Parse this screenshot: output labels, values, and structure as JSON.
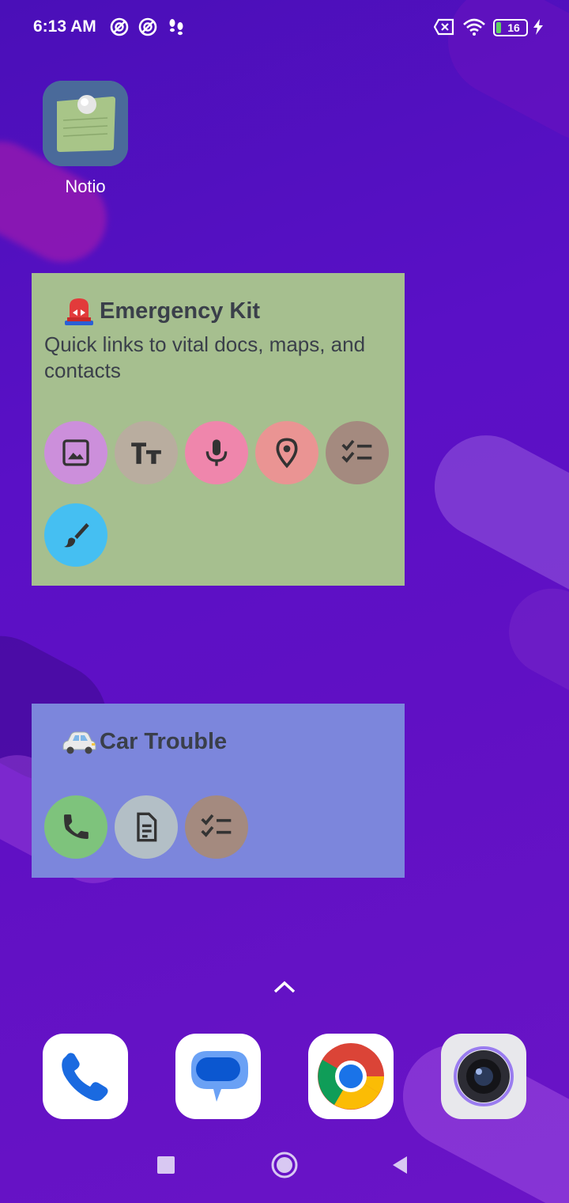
{
  "status_bar": {
    "time": "6:13 AM",
    "battery_level": "16",
    "icons": [
      "notification-icon",
      "notification-icon",
      "footsteps-icon",
      "sim-off-icon",
      "wifi-icon",
      "battery-icon",
      "charging-bolt-icon"
    ]
  },
  "home_apps": [
    {
      "name": "Notio",
      "icon": "sticky-note-icon"
    }
  ],
  "widgets": [
    {
      "title": "Emergency Kit",
      "emoji": "emergency-light-icon",
      "description": "Quick links to vital docs, maps, and contacts",
      "actions": [
        {
          "icon": "image-icon",
          "color": "#cc8fdb"
        },
        {
          "icon": "text-format-icon",
          "color": "#b9ad9f"
        },
        {
          "icon": "microphone-icon",
          "color": "#ef86ac"
        },
        {
          "icon": "location-pin-icon",
          "color": "#ea9493"
        },
        {
          "icon": "checklist-icon",
          "color": "#a48a7f"
        },
        {
          "icon": "brush-icon",
          "color": "#45bff2"
        }
      ]
    },
    {
      "title": "Car Trouble",
      "emoji": "car-icon",
      "description": "",
      "actions": [
        {
          "icon": "phone-icon",
          "color": "#7ec37c"
        },
        {
          "icon": "document-icon",
          "color": "#b3bfc6"
        },
        {
          "icon": "checklist-icon",
          "color": "#a48a7f"
        }
      ]
    }
  ],
  "dock": [
    {
      "icon": "phone-app-icon"
    },
    {
      "icon": "messages-app-icon"
    },
    {
      "icon": "chrome-app-icon"
    },
    {
      "icon": "camera-app-icon"
    }
  ],
  "navigation": [
    "recents-button",
    "home-button",
    "back-button"
  ],
  "colors": {
    "accent_green_widget": "#a6bf8f",
    "accent_blue_widget": "#7c86dc",
    "wallpaper": "#5a10c6"
  }
}
